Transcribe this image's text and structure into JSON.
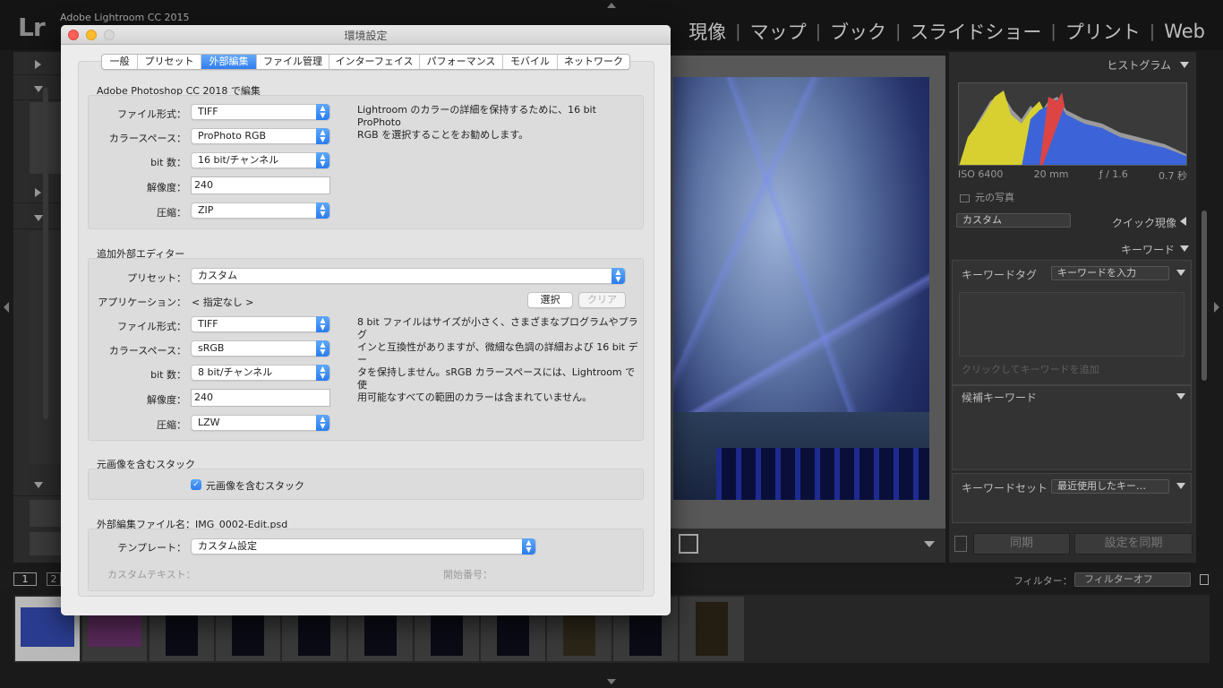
{
  "app": {
    "logo": "Lr",
    "name": "Adobe Lightroom CC 2015",
    "modules": [
      "現像",
      "マップ",
      "ブック",
      "スライドショー",
      "プリント",
      "Web"
    ]
  },
  "right_panel": {
    "histogram_header": "ヒストグラム",
    "exif": {
      "iso": "ISO 6400",
      "focal": "20 mm",
      "aperture": "ƒ / 1.6",
      "shutter": "0.7 秒"
    },
    "original_photo": "元の写真",
    "preset_select": "カスタム",
    "quick_develop": "クイック現像",
    "keyword_header": "キーワード",
    "keyword_tag_label": "キーワードタグ",
    "keyword_tag_select": "キーワードを入力",
    "keyword_placeholder": "クリックしてキーワードを追加",
    "suggested_keywords": "候補キーワード",
    "keyword_set_label": "キーワードセット",
    "keyword_set_select": "最近使用したキー…",
    "sync_button": "同期",
    "sync_settings_button": "設定を同期"
  },
  "filmstrip": {
    "page1": "1",
    "page2": "2",
    "filter_label": "フィルター：",
    "filter_value": "フィルターオフ"
  },
  "dialog": {
    "title": "環境設定",
    "tabs": [
      "一般",
      "プリセット",
      "外部編集",
      "ファイル管理",
      "インターフェイス",
      "パフォーマンス",
      "モバイル",
      "ネットワーク"
    ],
    "active_tab": "外部編集",
    "photoshop": {
      "section_title": "Adobe Photoshop CC 2018 で編集",
      "file_format_label": "ファイル形式：",
      "file_format": "TIFF",
      "color_space_label": "カラースペース：",
      "color_space": "ProPhoto RGB",
      "bit_depth_label": "bit 数：",
      "bit_depth": "16 bit/チャンネル",
      "resolution_label": "解像度：",
      "resolution": "240",
      "compression_label": "圧縮：",
      "compression": "ZIP",
      "hint_line1": "Lightroom のカラーの詳細を保持するために、16 bit ProPhoto",
      "hint_line2": "RGB を選択することをお勧めします。"
    },
    "additional": {
      "section_title": "追加外部エディター",
      "preset_label": "プリセット：",
      "preset": "カスタム",
      "application_label": "アプリケーション：",
      "application_value": "< 指定なし >",
      "choose_button": "選択",
      "clear_button": "クリア",
      "file_format_label": "ファイル形式：",
      "file_format": "TIFF",
      "color_space_label": "カラースペース：",
      "color_space": "sRGB",
      "bit_depth_label": "bit 数：",
      "bit_depth": "8 bit/チャンネル",
      "resolution_label": "解像度：",
      "resolution": "240",
      "compression_label": "圧縮：",
      "compression": "LZW",
      "hint_line1": "8 bit ファイルはサイズが小さく、さまざまなプログラムやプラグ",
      "hint_line2": "インと互換性がありますが、微細な色調の詳細および 16 bit デー",
      "hint_line3": "タを保持しません。sRGB カラースペースには、Lightroom で使",
      "hint_line4": "用可能なすべての範囲のカラーは含まれていません。"
    },
    "stack": {
      "section_title": "元画像を含むスタック",
      "checkbox_label": "元画像を含むスタック",
      "checked": true
    },
    "naming": {
      "section_title": "外部編集ファイル名：IMG_0002-Edit.psd",
      "template_label": "テンプレート：",
      "template": "カスタム設定",
      "custom_text_label": "カスタムテキスト：",
      "start_number_label": "開始番号："
    }
  }
}
